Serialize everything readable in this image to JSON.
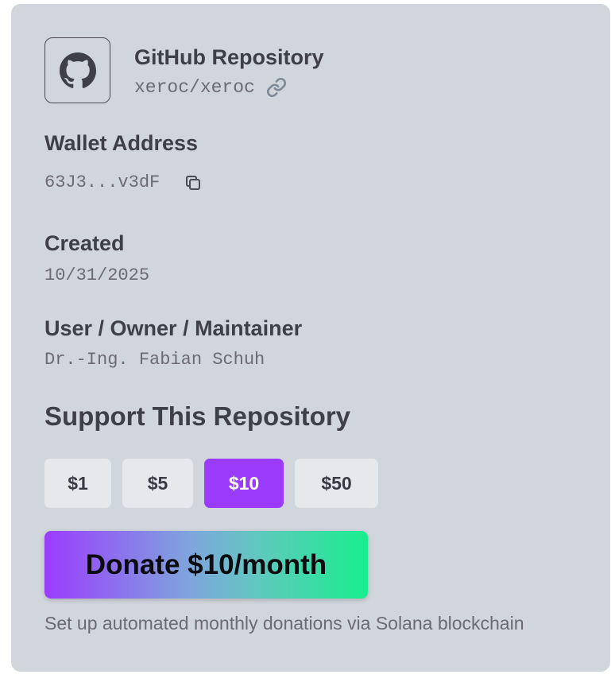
{
  "repo": {
    "title": "GitHub Repository",
    "name": "xeroc/xeroc",
    "icon": "github-icon",
    "link_icon": "link-icon"
  },
  "wallet": {
    "label": "Wallet Address",
    "address": "63J3...v3dF",
    "copy_icon": "copy-icon"
  },
  "created": {
    "label": "Created",
    "date": "10/31/2025"
  },
  "owner": {
    "label": "User / Owner / Maintainer",
    "name": "Dr.-Ing. Fabian Schuh"
  },
  "support": {
    "title": "Support This Repository",
    "amounts": [
      "$1",
      "$5",
      "$10",
      "$50"
    ],
    "selected_amount": "$10",
    "donate_label": "Donate $10/month",
    "note": "Set up automated monthly donations via Solana blockchain"
  },
  "colors": {
    "card_bg": "#d1d5dc",
    "accent": "#9b3cfd",
    "gradient_end": "#18ee8e"
  }
}
